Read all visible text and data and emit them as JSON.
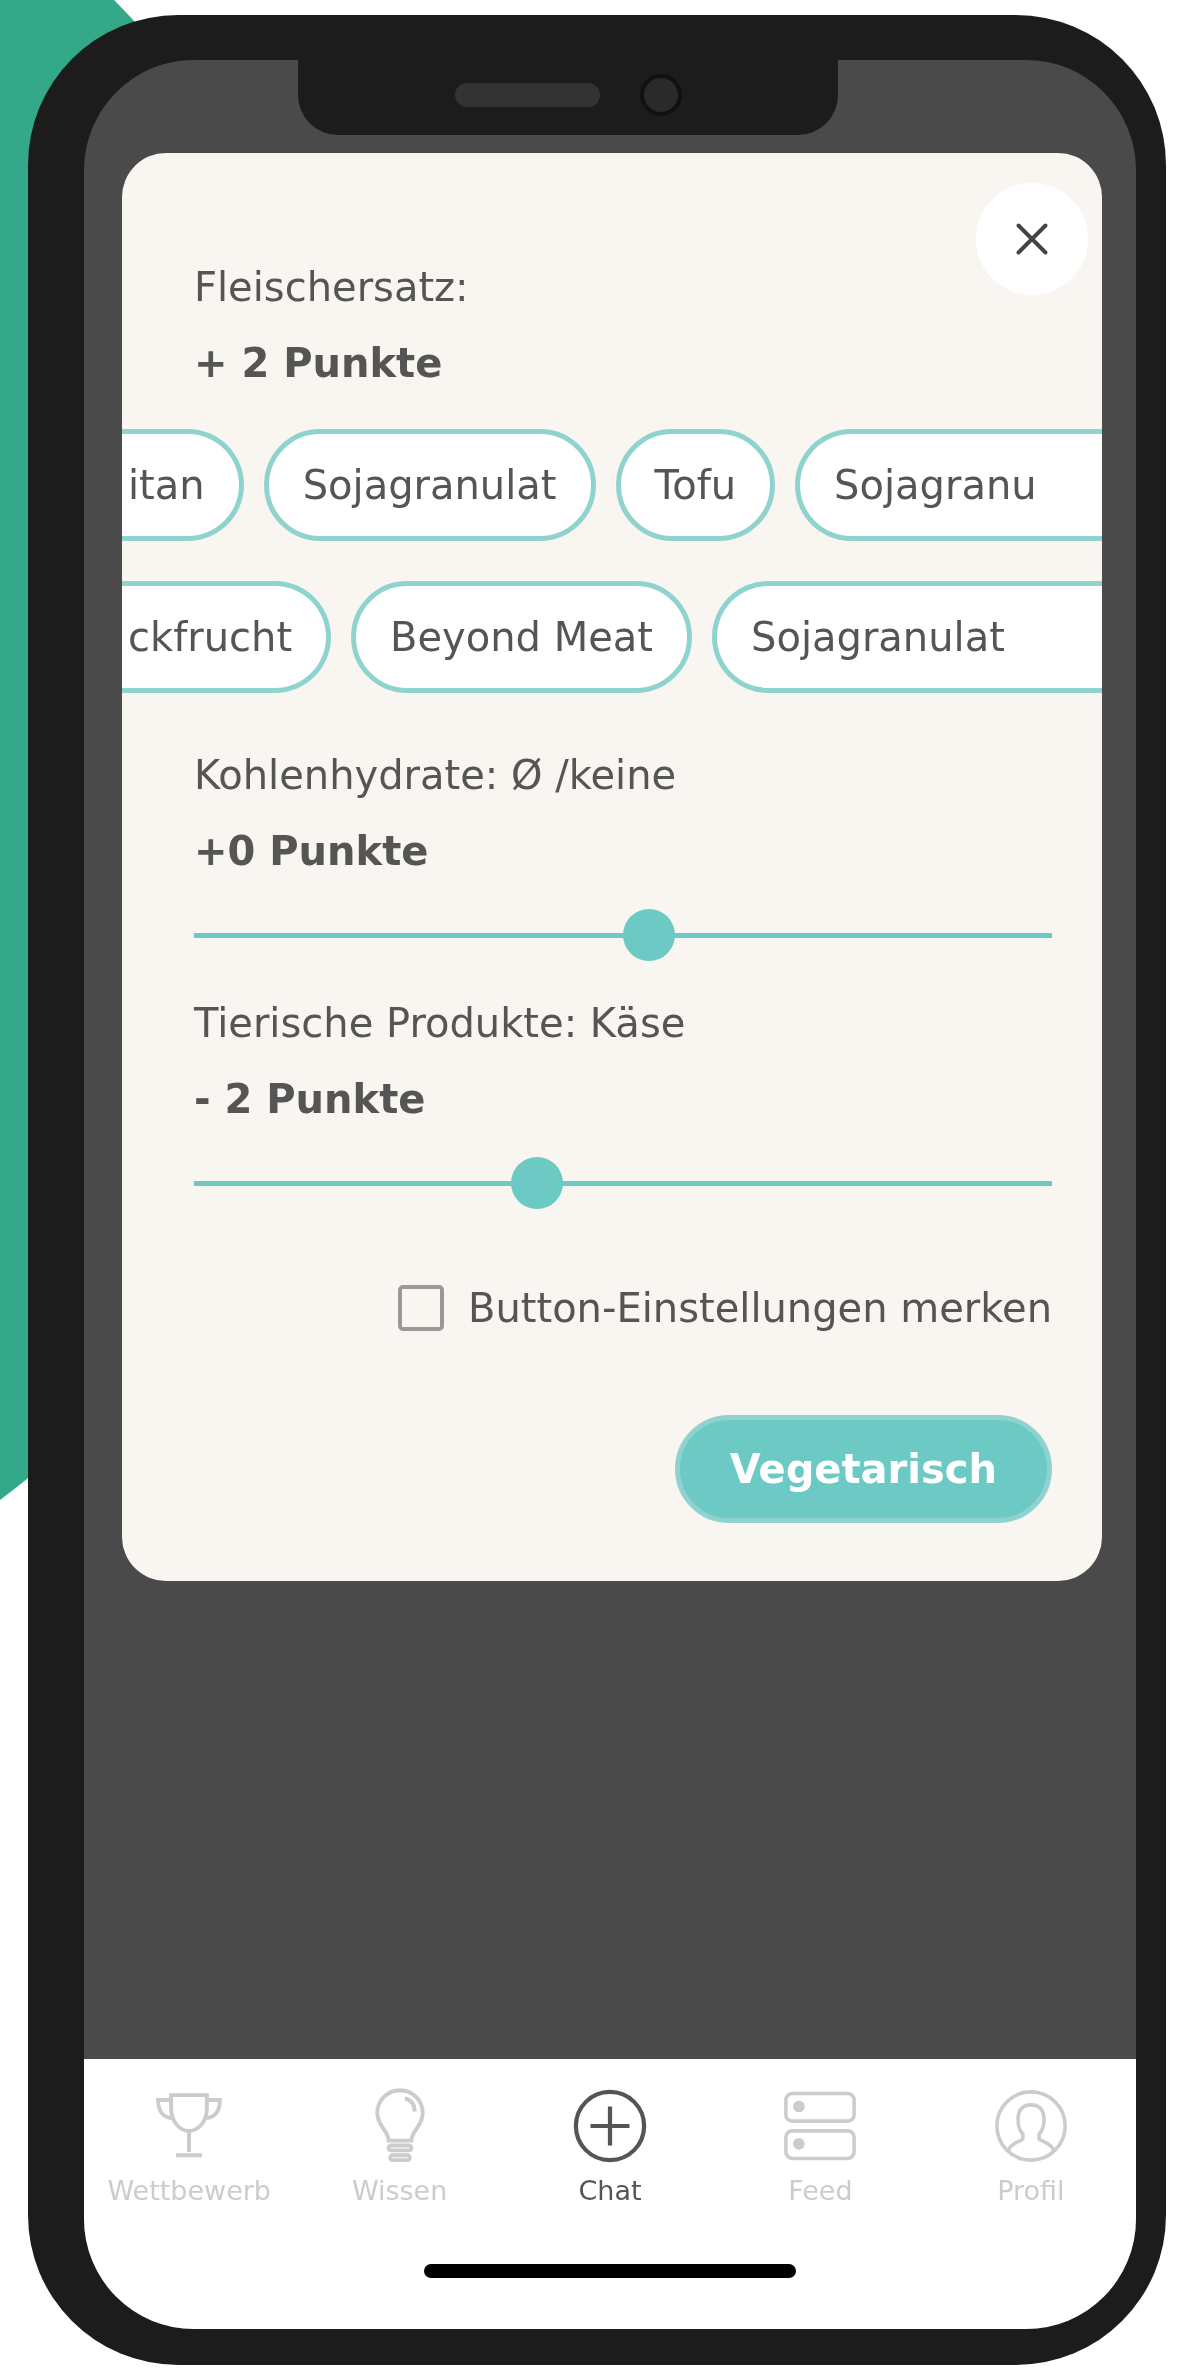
{
  "modal": {
    "sections": [
      {
        "kind": "chips",
        "title": "Fleischersatz:",
        "points": "+ 2 Punkte",
        "chip_rows": [
          {
            "clipped_left": true,
            "clipped_right": true,
            "chips": [
              "itan",
              "Sojagranulat",
              "Tofu",
              "Sojagranu"
            ]
          },
          {
            "clipped_left": true,
            "clipped_right": true,
            "chips": [
              "ckfrucht",
              "Beyond Meat",
              "Sojagranulat"
            ]
          }
        ]
      },
      {
        "kind": "slider",
        "title": "Kohlenhydrate: Ø /keine",
        "points": "+0 Punkte",
        "level": 0.53
      },
      {
        "kind": "slider",
        "title": "Tierische Produkte: Käse",
        "points": "- 2 Punkte",
        "level": 0.4
      }
    ],
    "remember": {
      "label": "Button-Einstellungen merken",
      "checked": false
    },
    "button": "Vegetarisch"
  },
  "nav": [
    {
      "kind": "trophy",
      "label": "Wettbewerb",
      "selected": false
    },
    {
      "kind": "bulb",
      "label": "Wissen",
      "selected": false
    },
    {
      "kind": "plus",
      "label": "Chat",
      "selected": true
    },
    {
      "kind": "feed",
      "label": "Feed",
      "selected": false
    },
    {
      "kind": "profile",
      "label": "Profil",
      "selected": false
    }
  ]
}
